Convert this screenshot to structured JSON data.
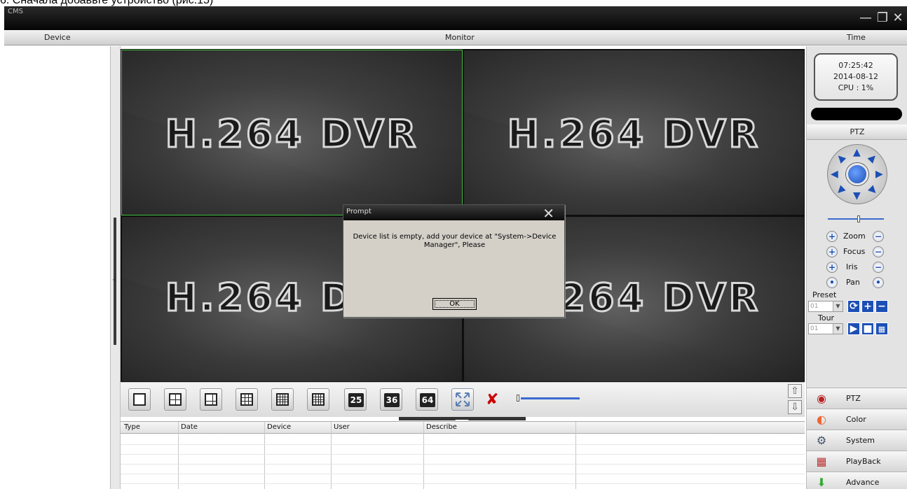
{
  "caption": "6. Сначала добавьте устройство (рис.15)",
  "app": {
    "title": "CMS"
  },
  "header": {
    "device": "Device",
    "monitor": "Monitor",
    "time": "Time"
  },
  "video": {
    "logo_text": "H.264 DVR"
  },
  "dialog": {
    "title": "Prompt",
    "message": "Device list is empty, add your device at \"System->Device Manager\", Please",
    "ok_label": "OK"
  },
  "toolbar": {
    "split_buttons": [
      "25",
      "36",
      "64"
    ]
  },
  "log_table": {
    "columns": [
      "Type",
      "Date",
      "Device",
      "User",
      "Describe"
    ]
  },
  "status": {
    "time": "07:25:42",
    "date": "2014-08-12",
    "cpu": "CPU : 1%"
  },
  "ptz": {
    "header": "PTZ",
    "zoom": "Zoom",
    "focus": "Focus",
    "iris": "Iris",
    "pan": "Pan",
    "preset_label": "Preset",
    "preset_value": "01",
    "tour_label": "Tour",
    "tour_value": "01"
  },
  "side_menu": [
    "PTZ",
    "Color",
    "System",
    "PlayBack",
    "Advance"
  ],
  "colors": {
    "active_pane_border": "#3fbf3f",
    "accent_blue": "#1c4fb5",
    "volume_line": "#3a6ad0"
  }
}
